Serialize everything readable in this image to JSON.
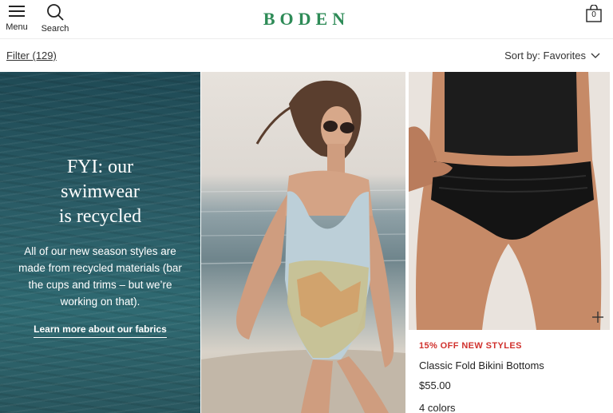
{
  "header": {
    "menu_label": "Menu",
    "search_label": "Search",
    "brand": "BODEN",
    "bag_count": "0",
    "brand_color": "#2e8b57"
  },
  "toolbar": {
    "filter_label": "Filter (129)",
    "sort_label": "Sort by: Favorites"
  },
  "promo": {
    "title_line1": "FYI: our",
    "title_line2": "swimwear",
    "title_line3": "is recycled",
    "body": "All of our new season styles are made from recycled materials (bar the cups and trims – but we’re working on that).",
    "link": "Learn more about our fabrics"
  },
  "product": {
    "tag": "15% OFF NEW STYLES",
    "name": "Classic Fold Bikini Bottoms",
    "price": "$55.00",
    "colors": "4 colors",
    "tag_color": "#d0312d"
  },
  "icons": [
    "hamburger-menu-icon",
    "search-icon",
    "shopping-bag-icon",
    "chevron-down-icon",
    "plus-icon"
  ]
}
